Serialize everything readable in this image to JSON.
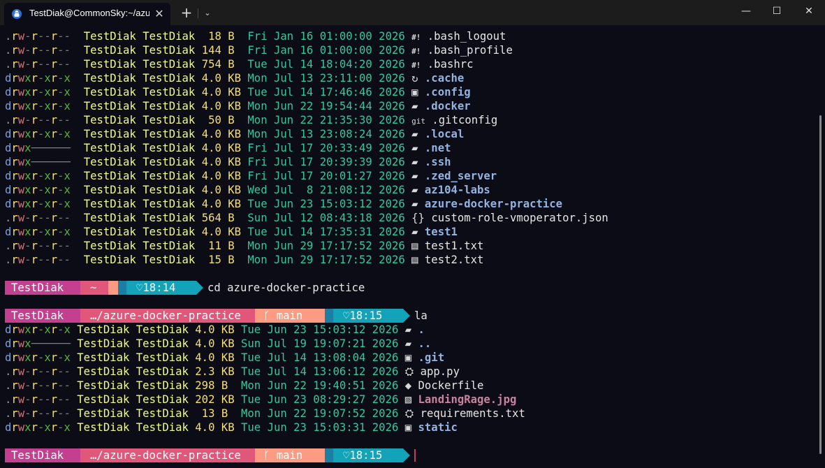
{
  "window": {
    "tab_title": "TestDiak@CommonSky:~/azu",
    "newtab_label": "+",
    "dropdown_label": "⌄",
    "close_tab_label": "✕",
    "minimize_label": "—",
    "maximize_label": "☐",
    "close_label": "✕"
  },
  "colors": {
    "bg": "#0c0c16",
    "prompt_user": "#c2408f",
    "prompt_path": "#e15779",
    "prompt_git": "#fc9a82",
    "prompt_time": "#12a3b8",
    "prompt_cyan": "#1a7fa3"
  },
  "listing1": [
    {
      "perm": ".rw-r--r--",
      "user": "TestDiak",
      "group": "TestDiak",
      "size": " 18 B ",
      "date": "Fri Jan 16 01:00:00 2026",
      "icon": "#!",
      "icon_name": "shell-script-icon",
      "name": ".bash_logout",
      "kind": "file"
    },
    {
      "perm": ".rw-r--r--",
      "user": "TestDiak",
      "group": "TestDiak",
      "size": "144 B ",
      "date": "Fri Jan 16 01:00:00 2026",
      "icon": "#!",
      "icon_name": "shell-script-icon",
      "name": ".bash_profile",
      "kind": "file"
    },
    {
      "perm": ".rw-r--r--",
      "user": "TestDiak",
      "group": "TestDiak",
      "size": "754 B ",
      "date": "Tue Jul 14 18:04:20 2026",
      "icon": "#!",
      "icon_name": "shell-script-icon",
      "name": ".bashrc",
      "kind": "file"
    },
    {
      "perm": "drwxr-xr-x",
      "user": "TestDiak",
      "group": "TestDiak",
      "size": "4.0 KB",
      "date": "Mon Jul 13 23:11:00 2026",
      "icon": "↻",
      "icon_name": "cache-icon",
      "name": ".cache",
      "kind": "dir"
    },
    {
      "perm": "drwxr-xr-x",
      "user": "TestDiak",
      "group": "TestDiak",
      "size": "4.0 KB",
      "date": "Tue Jul 14 17:46:46 2026",
      "icon": "▣",
      "icon_name": "config-folder-icon",
      "name": ".config",
      "kind": "dir"
    },
    {
      "perm": "drwxr-xr-x",
      "user": "TestDiak",
      "group": "TestDiak",
      "size": "4.0 KB",
      "date": "Mon Jun 22 19:54:44 2026",
      "icon": "▰",
      "icon_name": "folder-icon",
      "name": ".docker",
      "kind": "dir"
    },
    {
      "perm": ".rw-r--r--",
      "user": "TestDiak",
      "group": "TestDiak",
      "size": " 50 B ",
      "date": "Mon Jun 22 21:35:30 2026",
      "icon": "git",
      "icon_name": "git-icon",
      "name": ".gitconfig",
      "kind": "file"
    },
    {
      "perm": "drwxr-xr-x",
      "user": "TestDiak",
      "group": "TestDiak",
      "size": "4.0 KB",
      "date": "Mon Jul 13 23:08:24 2026",
      "icon": "▰",
      "icon_name": "folder-icon",
      "name": ".local",
      "kind": "dir"
    },
    {
      "perm": "drwx------",
      "user": "TestDiak",
      "group": "TestDiak",
      "size": "4.0 KB",
      "date": "Fri Jul 17 20:33:49 2026",
      "icon": "▰",
      "icon_name": "folder-icon",
      "name": ".net",
      "kind": "dir"
    },
    {
      "perm": "drwx------",
      "user": "TestDiak",
      "group": "TestDiak",
      "size": "4.0 KB",
      "date": "Fri Jul 17 20:39:39 2026",
      "icon": "▰",
      "icon_name": "ssh-folder-icon",
      "name": ".ssh",
      "kind": "dir"
    },
    {
      "perm": "drwxr-xr-x",
      "user": "TestDiak",
      "group": "TestDiak",
      "size": "4.0 KB",
      "date": "Fri Jul 17 20:01:27 2026",
      "icon": "▰",
      "icon_name": "folder-icon",
      "name": ".zed_server",
      "kind": "dir"
    },
    {
      "perm": "drwxr-xr-x",
      "user": "TestDiak",
      "group": "TestDiak",
      "size": "4.0 KB",
      "date": "Wed Jul  8 21:08:12 2026",
      "icon": "▰",
      "icon_name": "folder-icon",
      "name": "az104-labs",
      "kind": "dir"
    },
    {
      "perm": "drwxr-xr-x",
      "user": "TestDiak",
      "group": "TestDiak",
      "size": "4.0 KB",
      "date": "Tue Jun 23 15:03:12 2026",
      "icon": "▰",
      "icon_name": "folder-icon",
      "name": "azure-docker-practice",
      "kind": "dir"
    },
    {
      "perm": ".rw-r--r--",
      "user": "TestDiak",
      "group": "TestDiak",
      "size": "564 B ",
      "date": "Sun Jul 12 08:43:18 2026",
      "icon": "{}",
      "icon_name": "json-icon",
      "name": "custom-role-vmoperator.json",
      "kind": "file"
    },
    {
      "perm": "drwxr-xr-x",
      "user": "TestDiak",
      "group": "TestDiak",
      "size": "4.0 KB",
      "date": "Tue Jul 14 17:35:31 2026",
      "icon": "▰",
      "icon_name": "folder-icon",
      "name": "test1",
      "kind": "dir"
    },
    {
      "perm": ".rw-r--r--",
      "user": "TestDiak",
      "group": "TestDiak",
      "size": " 11 B ",
      "date": "Mon Jun 29 17:17:52 2026",
      "icon": "▤",
      "icon_name": "text-file-icon",
      "name": "test1.txt",
      "kind": "file"
    },
    {
      "perm": ".rw-r--r--",
      "user": "TestDiak",
      "group": "TestDiak",
      "size": " 15 B ",
      "date": "Mon Jun 29 17:17:52 2026",
      "icon": "▤",
      "icon_name": "text-file-icon",
      "name": "test2.txt",
      "kind": "file"
    }
  ],
  "prompt1": {
    "user": "TestDiak",
    "path": "~",
    "time": "18:14",
    "command": "cd azure-docker-practice"
  },
  "prompt2": {
    "user": "TestDiak",
    "path": "…/azure-docker-practice",
    "branch": "main",
    "time": "18:15",
    "command": "la"
  },
  "listing2": [
    {
      "perm": "drwxr-xr-x",
      "user": "TestDiak",
      "group": "TestDiak",
      "size": "4.0 KB",
      "date": "Tue Jun 23 15:03:12 2026",
      "icon": "▰",
      "icon_name": "folder-icon",
      "name": ".",
      "kind": "dir"
    },
    {
      "perm": "drwx------",
      "user": "TestDiak",
      "group": "TestDiak",
      "size": "4.0 KB",
      "date": "Sun Jul 19 19:07:21 2026",
      "icon": "▰",
      "icon_name": "folder-icon",
      "name": "..",
      "kind": "dir"
    },
    {
      "perm": "drwxr-xr-x",
      "user": "TestDiak",
      "group": "TestDiak",
      "size": "4.0 KB",
      "date": "Tue Jul 14 13:08:04 2026",
      "icon": "▣",
      "icon_name": "git-folder-icon",
      "name": ".git",
      "kind": "dir"
    },
    {
      "perm": ".rw-r--r--",
      "user": "TestDiak",
      "group": "TestDiak",
      "size": "2.3 KB",
      "date": "Tue Jul 14 13:06:12 2026",
      "icon": "⛭",
      "icon_name": "python-icon",
      "name": "app.py",
      "kind": "file"
    },
    {
      "perm": ".rw-r--r--",
      "user": "TestDiak",
      "group": "TestDiak",
      "size": "298 B ",
      "date": "Mon Jun 22 19:40:51 2026",
      "icon": "◆",
      "icon_name": "docker-icon",
      "name": "Dockerfile",
      "kind": "file"
    },
    {
      "perm": ".rw-r--r--",
      "user": "TestDiak",
      "group": "TestDiak",
      "size": "202 KB",
      "date": "Tue Jun 23 08:29:27 2026",
      "icon": "▧",
      "icon_name": "image-file-icon",
      "name": "LandingRage.jpg",
      "kind": "img"
    },
    {
      "perm": ".rw-r--r--",
      "user": "TestDiak",
      "group": "TestDiak",
      "size": " 13 B ",
      "date": "Mon Jun 22 19:07:52 2026",
      "icon": "⛭",
      "icon_name": "python-icon",
      "name": "requirements.txt",
      "kind": "file"
    },
    {
      "perm": "drwxr-xr-x",
      "user": "TestDiak",
      "group": "TestDiak",
      "size": "4.0 KB",
      "date": "Tue Jun 23 15:03:31 2026",
      "icon": "▣",
      "icon_name": "static-folder-icon",
      "name": "static",
      "kind": "dir"
    }
  ],
  "prompt3": {
    "user": "TestDiak",
    "path": "…/azure-docker-practice",
    "branch": "main",
    "time": "18:15",
    "command": ""
  }
}
